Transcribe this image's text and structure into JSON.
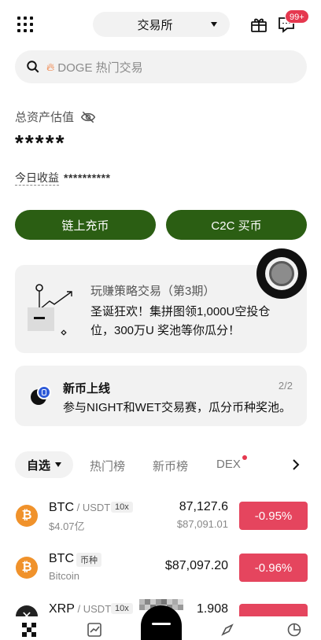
{
  "header": {
    "exchange_label": "交易所",
    "notif_badge": "99+"
  },
  "search": {
    "placeholder": "DOGE 热门交易"
  },
  "assets": {
    "title": "总资产估值",
    "value": "*****",
    "today_label": "今日收益",
    "today_value": "**********"
  },
  "actions": {
    "deposit": "链上充币",
    "c2c": "C2C 买币"
  },
  "promo": {
    "title": "玩赚策略交易（第3期）",
    "text": "圣诞狂欢！集拼图领1,000U空投仓位，300万U 奖池等你瓜分！"
  },
  "new_listing": {
    "title": "新币上线",
    "text": "参与NIGHT和WET交易赛，瓜分币种奖池。",
    "page": "2/2"
  },
  "tabs": {
    "active": "自选",
    "items": [
      "热门榜",
      "新币榜",
      "DEX"
    ]
  },
  "rows": [
    {
      "symbol": "BTC",
      "quote": " / USDT",
      "tag": "10x",
      "sub": "$4.07亿",
      "price": "87,127.6",
      "price_sub": "$87,091.01",
      "change": "-0.95%"
    },
    {
      "symbol": "BTC",
      "quote": "",
      "tag": "币种",
      "sub": "Bitcoin",
      "price": "$87,097.20",
      "price_sub": "",
      "change": "-0.96%"
    },
    {
      "symbol": "XRP",
      "quote": " / USDT",
      "tag": "10x",
      "sub": "",
      "price": "1.908",
      "price_sub": "",
      "change": ""
    }
  ],
  "colors": {
    "green": "#2b5e13",
    "red": "#e5455e",
    "btc": "#f0922b",
    "badge": "#e5384f"
  }
}
